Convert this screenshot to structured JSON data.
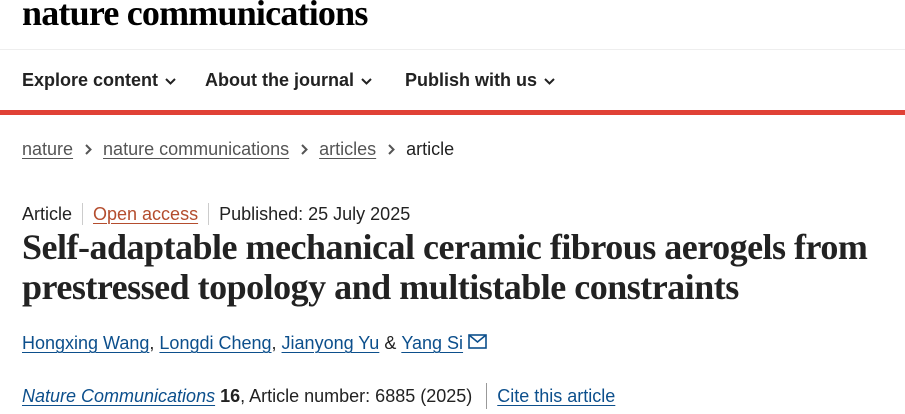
{
  "site": {
    "logo": "nature communications"
  },
  "nav": {
    "items": [
      {
        "label": "Explore content"
      },
      {
        "label": "About the journal"
      },
      {
        "label": "Publish with us"
      }
    ]
  },
  "breadcrumb": {
    "items": [
      "nature",
      "nature communications",
      "articles"
    ],
    "current": "article"
  },
  "meta": {
    "type": "Article",
    "access": "Open access",
    "published": "Published: 25 July 2025"
  },
  "article": {
    "title": "Self-adaptable mechanical ceramic fibrous aerogels from prestressed topology and multistable constraints"
  },
  "authors": {
    "list": [
      "Hongxing Wang",
      "Longdi Cheng",
      "Jianyong Yu",
      "Yang Si"
    ],
    "separator": ", ",
    "conjunction": " & "
  },
  "citation": {
    "journal": "Nature Communications",
    "volume": "16",
    "details": ", Article number: 6885 (2025)",
    "cite_label": "Cite this article"
  },
  "colors": {
    "accent_red": "#e04136",
    "link_blue": "#0c4f8c",
    "open_access_orange": "#b44d2e"
  },
  "icons": {
    "nav_chevron": "chevron-down-icon",
    "breadcrumb_separator": "chevron-right-icon",
    "corresponding_author": "mail-icon"
  }
}
